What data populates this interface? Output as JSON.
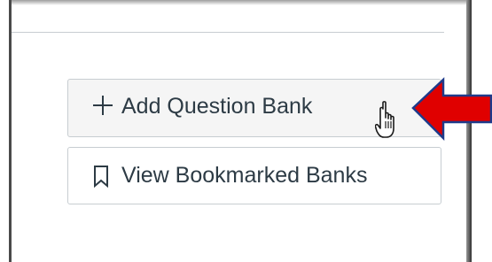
{
  "actions": {
    "add_bank_label": "Add Question Bank",
    "view_bookmarked_label": "View Bookmarked Banks"
  },
  "icons": {
    "add": "plus-icon",
    "bookmark": "bookmark-icon",
    "cursor": "hand-pointer-icon",
    "annotation": "red-arrow-icon"
  },
  "colors": {
    "text": "#2d3b45",
    "button_border": "#c7cdd1",
    "button_bg_hover": "#f5f5f5",
    "arrow_fill": "#e00000",
    "arrow_stroke": "#1f3a8a"
  }
}
